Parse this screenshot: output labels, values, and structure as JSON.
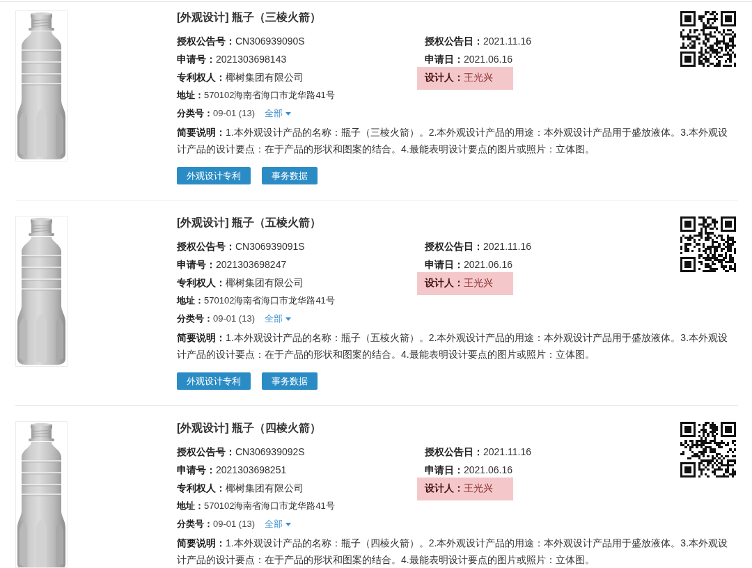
{
  "records": [
    {
      "title": "[外观设计] 瓶子（三棱火箭）",
      "left_fields": [
        {
          "label": "授权公告号：",
          "value": "CN306939090S"
        },
        {
          "label": "申请号：",
          "value": "2021303698143"
        },
        {
          "label": "专利权人：",
          "value": "椰树集团有限公司"
        }
      ],
      "right_fields": [
        {
          "label": "授权公告日：",
          "value": "2021.11.16",
          "highlighted": false
        },
        {
          "label": "申请日：",
          "value": "2021.06.16",
          "highlighted": false
        },
        {
          "label": "设计人：",
          "value": "王光兴",
          "highlighted": true
        }
      ],
      "address": {
        "label": "地址：",
        "value": "570102海南省海口市龙华路41号"
      },
      "classification": {
        "label": "分类号：",
        "value": "09-01 (13)",
        "toggle": "全部"
      },
      "summary": "**简要说明：**1.本外观设计产品的名称：瓶子（三棱火箭）。2.本外观设计产品的用途：本外观设计产品用于盛放液体。3.本外观设计产品的设计要点：在于产品的形状和图案的结合。4.最能表明设计要点的图片或照片：立体图。",
      "buttons": [
        "外观设计专利",
        "事务数据"
      ]
    },
    {
      "title": "[外观设计] 瓶子（五棱火箭）",
      "left_fields": [
        {
          "label": "授权公告号：",
          "value": "CN306939091S"
        },
        {
          "label": "申请号：",
          "value": "2021303698247"
        },
        {
          "label": "专利权人：",
          "value": "椰树集团有限公司"
        }
      ],
      "right_fields": [
        {
          "label": "授权公告日：",
          "value": "2021.11.16",
          "highlighted": false
        },
        {
          "label": "申请日：",
          "value": "2021.06.16",
          "highlighted": false
        },
        {
          "label": "设计人：",
          "value": "王光兴",
          "highlighted": true
        }
      ],
      "address": {
        "label": "地址：",
        "value": "570102海南省海口市龙华路41号"
      },
      "classification": {
        "label": "分类号：",
        "value": "09-01 (13)",
        "toggle": "全部"
      },
      "summary": "**简要说明：**1.本外观设计产品的名称：瓶子（五棱火箭）。2.本外观设计产品的用途：本外观设计产品用于盛放液体。3.本外观设计产品的设计要点：在于产品的形状和图案的结合。4.最能表明设计要点的图片或照片：立体图。",
      "buttons": [
        "外观设计专利",
        "事务数据"
      ]
    },
    {
      "title": "[外观设计] 瓶子（四棱火箭）",
      "left_fields": [
        {
          "label": "授权公告号：",
          "value": "CN306939092S"
        },
        {
          "label": "申请号：",
          "value": "2021303698251"
        },
        {
          "label": "专利权人：",
          "value": "椰树集团有限公司"
        }
      ],
      "right_fields": [
        {
          "label": "授权公告日：",
          "value": "2021.11.16",
          "highlighted": false
        },
        {
          "label": "申请日：",
          "value": "2021.06.16",
          "highlighted": false
        },
        {
          "label": "设计人：",
          "value": "王光兴",
          "highlighted": true
        }
      ],
      "address": {
        "label": "地址：",
        "value": "570102海南省海口市龙华路41号"
      },
      "classification": {
        "label": "分类号：",
        "value": "09-01 (13)",
        "toggle": "全部"
      },
      "summary": "**简要说明：**1.本外观设计产品的名称：瓶子（四棱火箭）。2.本外观设计产品的用途：本外观设计产品用于盛放液体。3.本外观设计产品的设计要点：在于产品的形状和图案的结合。4.最能表明设计要点的图片或照片：立体图。"
    }
  ]
}
